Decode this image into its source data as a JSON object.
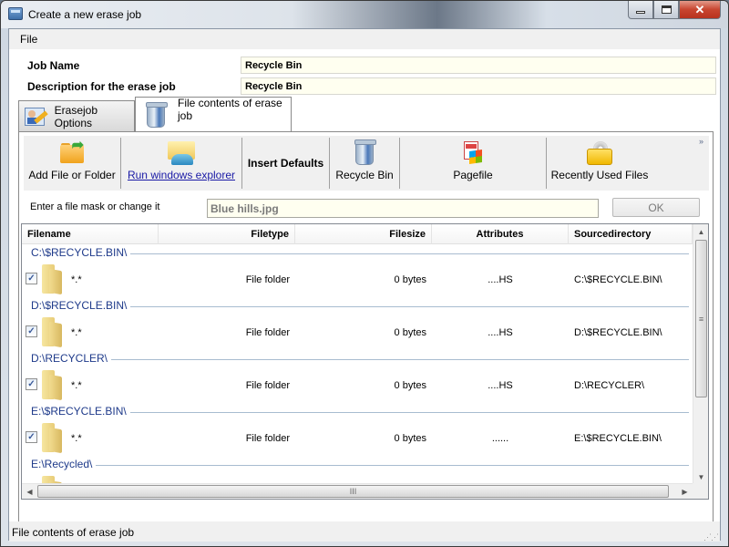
{
  "window": {
    "title": "Create a new erase job",
    "controls": {
      "minimize": "minimize",
      "maximize": "maximize",
      "close": "✕"
    }
  },
  "menu": {
    "items": [
      {
        "label": "File"
      }
    ]
  },
  "form": {
    "job_name_label": "Job Name",
    "job_name_value": "Recycle Bin",
    "description_label": "Description for the erase job",
    "description_value": "Recycle Bin"
  },
  "tabs": [
    {
      "label": "Erasejob Options",
      "icon": "erasejob-options-icon",
      "active": false
    },
    {
      "label": "File contents of erase job",
      "icon": "recycle-bin-icon",
      "active": true
    }
  ],
  "toolbar": {
    "buttons": [
      {
        "label": "Add File or Folder",
        "icon": "add-folder-icon"
      },
      {
        "label": "Run windows explorer",
        "icon": "windows-explorer-icon",
        "style": "link"
      },
      {
        "label": "Insert Defaults",
        "icon": "none",
        "style": "bold"
      },
      {
        "label": "Recycle Bin",
        "icon": "recycle-bin-icon"
      },
      {
        "label": "Pagefile",
        "icon": "pagefile-icon"
      },
      {
        "label": "Recently Used Files",
        "icon": "recent-files-icon"
      }
    ],
    "overflow": "»"
  },
  "mask": {
    "label": "Enter a file mask or change it",
    "value": "Blue hills.jpg",
    "ok_label": "OK"
  },
  "list": {
    "columns": [
      "Filename",
      "Filetype",
      "Filesize",
      "Attributes",
      "Sourcedirectory"
    ],
    "groups": [
      {
        "title": "C:\\$RECYCLE.BIN\\",
        "row": {
          "checked": true,
          "filename": "*.*",
          "filetype": "File folder",
          "filesize": "0 bytes",
          "attributes": "....HS",
          "source": "C:\\$RECYCLE.BIN\\"
        }
      },
      {
        "title": "D:\\$RECYCLE.BIN\\",
        "row": {
          "checked": true,
          "filename": "*.*",
          "filetype": "File folder",
          "filesize": "0 bytes",
          "attributes": "....HS",
          "source": "D:\\$RECYCLE.BIN\\"
        }
      },
      {
        "title": "D:\\RECYCLER\\",
        "row": {
          "checked": true,
          "filename": "*.*",
          "filetype": "File folder",
          "filesize": "0 bytes",
          "attributes": "....HS",
          "source": "D:\\RECYCLER\\"
        }
      },
      {
        "title": "E:\\$RECYCLE.BIN\\",
        "row": {
          "checked": true,
          "filename": "*.*",
          "filetype": "File folder",
          "filesize": "0 bytes",
          "attributes": "......",
          "source": "E:\\$RECYCLE.BIN\\"
        }
      },
      {
        "title": "E:\\Recycled\\"
      }
    ],
    "checkmark": "✓"
  },
  "scrollbars": {
    "up": "▲",
    "down": "▼",
    "left": "◀",
    "right": "▶",
    "grip_v": "≡",
    "grip_h": "III"
  },
  "status": {
    "text": "File contents of erase job"
  }
}
